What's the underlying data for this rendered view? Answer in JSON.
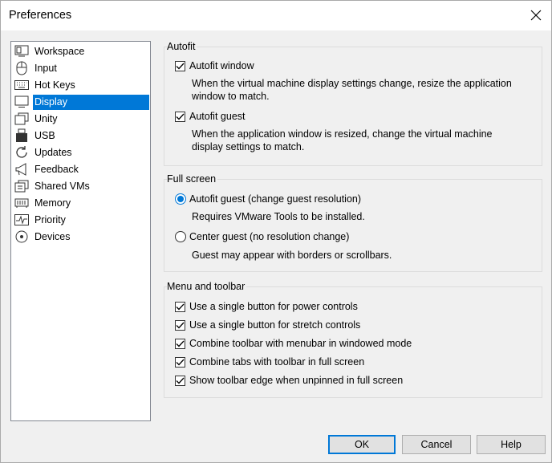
{
  "window": {
    "title": "Preferences"
  },
  "sidebar": {
    "items": [
      {
        "label": "Workspace",
        "icon": "workspace-icon"
      },
      {
        "label": "Input",
        "icon": "mouse-icon"
      },
      {
        "label": "Hot Keys",
        "icon": "keyboard-icon"
      },
      {
        "label": "Display",
        "icon": "monitor-icon",
        "selected": true
      },
      {
        "label": "Unity",
        "icon": "unity-icon"
      },
      {
        "label": "USB",
        "icon": "usb-icon"
      },
      {
        "label": "Updates",
        "icon": "refresh-icon"
      },
      {
        "label": "Feedback",
        "icon": "megaphone-icon"
      },
      {
        "label": "Shared VMs",
        "icon": "shared-vms-icon"
      },
      {
        "label": "Memory",
        "icon": "memory-icon"
      },
      {
        "label": "Priority",
        "icon": "pulse-icon"
      },
      {
        "label": "Devices",
        "icon": "devices-icon"
      }
    ]
  },
  "autofit": {
    "title": "Autofit",
    "window_label": "Autofit window",
    "window_checked": true,
    "window_desc_1": "When the virtual machine display settings change, resize the application",
    "window_desc_2": "window to match.",
    "guest_label": "Autofit guest",
    "guest_checked": true,
    "guest_desc_1": "When the application window is resized, change the virtual machine",
    "guest_desc_2": "display settings to match."
  },
  "fullscreen": {
    "title": "Full screen",
    "option1_label": "Autofit guest (change guest resolution)",
    "option1_desc": "Requires VMware Tools to be installed.",
    "option2_label": "Center guest (no resolution change)",
    "option2_desc": "Guest may appear with borders or scrollbars.",
    "selected": "option1"
  },
  "menu_toolbar": {
    "title": "Menu and toolbar",
    "options": [
      {
        "label": "Use a single button for power controls",
        "checked": true
      },
      {
        "label": "Use a single button for stretch controls",
        "checked": true
      },
      {
        "label": "Combine toolbar with menubar in windowed mode",
        "checked": true
      },
      {
        "label": "Combine tabs with toolbar in full screen",
        "checked": true
      },
      {
        "label": "Show toolbar edge when unpinned in full screen",
        "checked": true
      }
    ]
  },
  "buttons": {
    "ok": "OK",
    "cancel": "Cancel",
    "help": "Help"
  },
  "colors": {
    "accent": "#0078d7",
    "dialog_bg": "#f0f0f0",
    "button_bg": "#e1e1e1"
  }
}
